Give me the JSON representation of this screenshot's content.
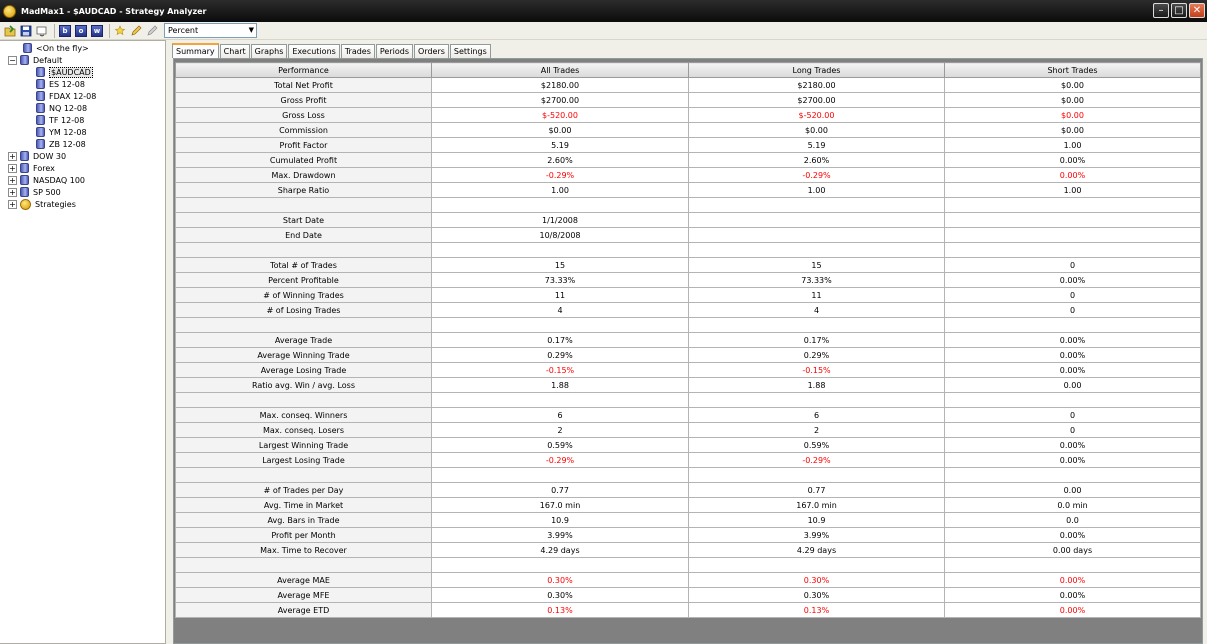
{
  "window": {
    "title": "MadMax1 - $AUDCAD - Strategy Analyzer"
  },
  "toolbar": {
    "mode_select": "Percent",
    "icons": [
      "open-icon",
      "save-icon",
      "refresh-icon",
      "b-icon",
      "o-icon",
      "w-icon",
      "wizard-icon",
      "edit-icon",
      "delete-icon"
    ],
    "b_label": "b",
    "o_label": "o",
    "w_label": "w"
  },
  "tree": {
    "on_the_fly": "<On the fly>",
    "default": "Default",
    "default_children": [
      "$AUDCAD",
      "ES 12-08",
      "FDAX 12-08",
      "NQ 12-08",
      "TF 12-08",
      "YM 12-08",
      "ZB 12-08"
    ],
    "groups": [
      "DOW 30",
      "Forex",
      "NASDAQ 100",
      "SP 500",
      "Strategies"
    ],
    "expander_collapsed": "+",
    "expander_expanded": "−"
  },
  "tabs": [
    "Summary",
    "Chart",
    "Graphs",
    "Executions",
    "Trades",
    "Periods",
    "Orders",
    "Settings"
  ],
  "colors": {
    "negative": "#ff0000",
    "tab_accent": "#f2a33a"
  },
  "table": {
    "headers": [
      "Performance",
      "All Trades",
      "Long Trades",
      "Short Trades"
    ],
    "rows": [
      [
        "Total Net Profit",
        "$2180.00",
        "$2180.00",
        "$0.00"
      ],
      [
        "Gross Profit",
        "$2700.00",
        "$2700.00",
        "$0.00"
      ],
      [
        "Gross Loss",
        "$-520.00",
        "$-520.00",
        "$0.00"
      ],
      [
        "Commission",
        "$0.00",
        "$0.00",
        "$0.00"
      ],
      [
        "Profit Factor",
        "5.19",
        "5.19",
        "1.00"
      ],
      [
        "Cumulated Profit",
        "2.60%",
        "2.60%",
        "0.00%"
      ],
      [
        "Max. Drawdown",
        "-0.29%",
        "-0.29%",
        "0.00%"
      ],
      [
        "Sharpe Ratio",
        "1.00",
        "1.00",
        "1.00"
      ],
      [
        "",
        "",
        "",
        ""
      ],
      [
        "Start Date",
        "1/1/2008",
        "",
        ""
      ],
      [
        "End Date",
        "10/8/2008",
        "",
        ""
      ],
      [
        "",
        "",
        "",
        ""
      ],
      [
        "Total # of Trades",
        "15",
        "15",
        "0"
      ],
      [
        "Percent Profitable",
        "73.33%",
        "73.33%",
        "0.00%"
      ],
      [
        "# of Winning Trades",
        "11",
        "11",
        "0"
      ],
      [
        "# of Losing Trades",
        "4",
        "4",
        "0"
      ],
      [
        "",
        "",
        "",
        ""
      ],
      [
        "Average Trade",
        "0.17%",
        "0.17%",
        "0.00%"
      ],
      [
        "Average Winning Trade",
        "0.29%",
        "0.29%",
        "0.00%"
      ],
      [
        "Average Losing Trade",
        "-0.15%",
        "-0.15%",
        "0.00%"
      ],
      [
        "Ratio avg. Win / avg. Loss",
        "1.88",
        "1.88",
        "0.00"
      ],
      [
        "",
        "",
        "",
        ""
      ],
      [
        "Max. conseq. Winners",
        "6",
        "6",
        "0"
      ],
      [
        "Max. conseq. Losers",
        "2",
        "2",
        "0"
      ],
      [
        "Largest Winning Trade",
        "0.59%",
        "0.59%",
        "0.00%"
      ],
      [
        "Largest Losing Trade",
        "-0.29%",
        "-0.29%",
        "0.00%"
      ],
      [
        "",
        "",
        "",
        ""
      ],
      [
        "# of Trades per Day",
        "0.77",
        "0.77",
        "0.00"
      ],
      [
        "Avg. Time in Market",
        "167.0 min",
        "167.0 min",
        "0.0 min"
      ],
      [
        "Avg. Bars in Trade",
        "10.9",
        "10.9",
        "0.0"
      ],
      [
        "Profit per Month",
        "3.99%",
        "3.99%",
        "0.00%"
      ],
      [
        "Max. Time to Recover",
        "4.29 days",
        "4.29 days",
        "0.00 days"
      ],
      [
        "",
        "",
        "",
        ""
      ],
      [
        "Average MAE",
        "0.30%",
        "0.30%",
        "0.00%"
      ],
      [
        "Average MFE",
        "0.30%",
        "0.30%",
        "0.00%"
      ],
      [
        "Average ETD",
        "0.13%",
        "0.13%",
        "0.00%"
      ]
    ],
    "red_cells": [
      [
        2,
        1
      ],
      [
        2,
        2
      ],
      [
        2,
        3
      ],
      [
        6,
        1
      ],
      [
        6,
        2
      ],
      [
        6,
        3
      ],
      [
        19,
        1
      ],
      [
        19,
        2
      ],
      [
        25,
        1
      ],
      [
        25,
        2
      ],
      [
        33,
        1
      ],
      [
        33,
        2
      ],
      [
        33,
        3
      ],
      [
        35,
        1
      ],
      [
        35,
        2
      ],
      [
        35,
        3
      ]
    ]
  }
}
